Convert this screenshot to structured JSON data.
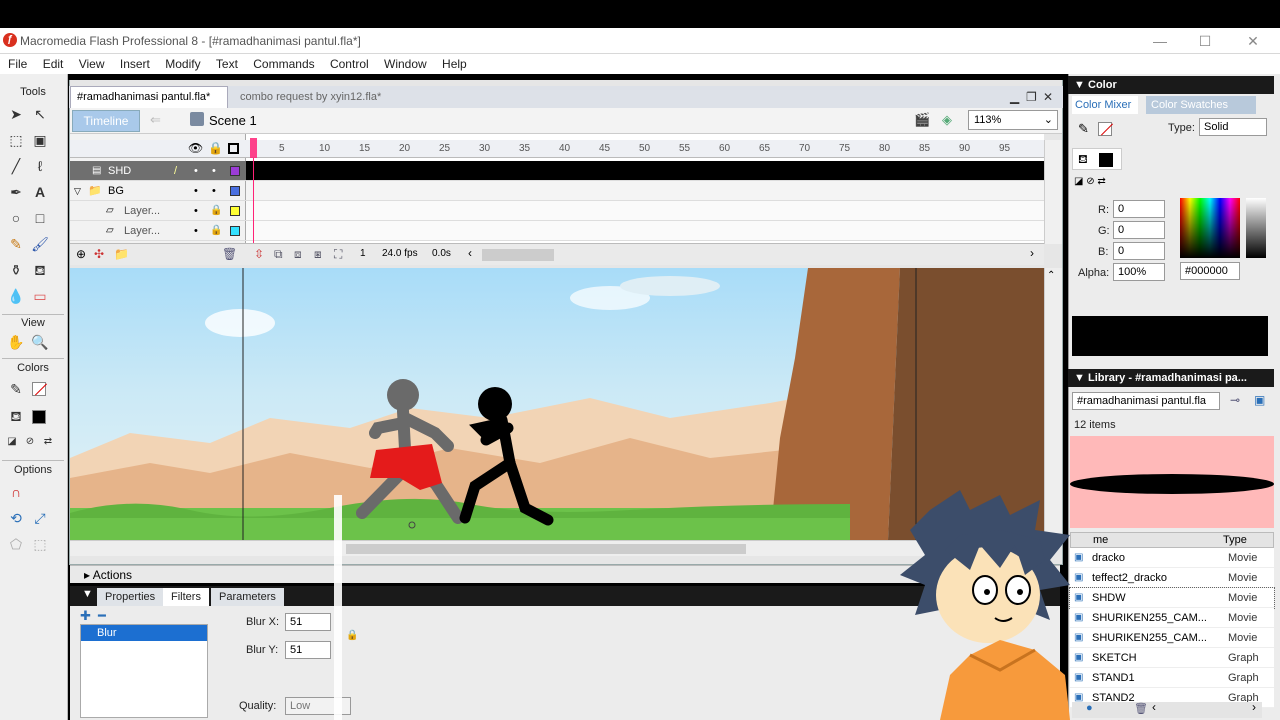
{
  "app": {
    "title": "Macromedia Flash Professional 8 - [#ramadhanimasi pantul.fla*]"
  },
  "menu": [
    "File",
    "Edit",
    "View",
    "Insert",
    "Modify",
    "Text",
    "Commands",
    "Control",
    "Window",
    "Help"
  ],
  "tools": {
    "header": "Tools",
    "view": "View",
    "colors": "Colors",
    "options": "Options"
  },
  "doc": {
    "tabs": [
      "#ramadhanimasi pantul.fla*",
      "combo request by xyin12.fla*"
    ],
    "timeline_btn": "Timeline",
    "scene": "Scene 1",
    "zoom": "113%"
  },
  "timeline": {
    "ruler": [
      "5",
      "10",
      "15",
      "20",
      "25",
      "30",
      "35",
      "40",
      "45",
      "50",
      "55",
      "60",
      "65",
      "70",
      "75",
      "80",
      "85",
      "90",
      "95"
    ],
    "layers": [
      {
        "name": "SHD",
        "color": "#9b3cd6"
      },
      {
        "name": "BG",
        "color": "#4a6fe0"
      },
      {
        "name": "Layer...",
        "color": "#ffff33"
      },
      {
        "name": "Layer...",
        "color": "#33e0ff"
      }
    ],
    "frame": "1",
    "fps": "24.0 fps",
    "time": "0.0s"
  },
  "panels": {
    "actions": "Actions",
    "prop_tabs": [
      "Properties",
      "Filters",
      "Parameters"
    ],
    "filter_item": "Blur",
    "blur_x_label": "Blur X:",
    "blur_x": "51",
    "blur_y_label": "Blur Y:",
    "blur_y": "51",
    "quality_label": "Quality:",
    "quality": "Low"
  },
  "color": {
    "title": "Color",
    "tabs": [
      "Color Mixer",
      "Color Swatches"
    ],
    "type_label": "Type:",
    "type": "Solid",
    "r_label": "R:",
    "r": "0",
    "g_label": "G:",
    "g": "0",
    "b_label": "B:",
    "b": "0",
    "alpha_label": "Alpha:",
    "alpha": "100%",
    "hex": "#000000"
  },
  "library": {
    "title": "Library - #ramadhanimasi pa...",
    "doc": "#ramadhanimasi pantul.fla",
    "count": "12 items",
    "col_name": "me",
    "col_type": "Type",
    "items": [
      {
        "name": "dracko",
        "type": "Movie"
      },
      {
        "name": "teffect2_dracko",
        "type": "Movie"
      },
      {
        "name": "SHDW",
        "type": "Movie"
      },
      {
        "name": "SHURIKEN255_CAM...",
        "type": "Movie"
      },
      {
        "name": "SHURIKEN255_CAM...",
        "type": "Movie"
      },
      {
        "name": "SKETCH",
        "type": "Graph"
      },
      {
        "name": "STAND1",
        "type": "Graph"
      },
      {
        "name": "STAND2",
        "type": "Graph"
      }
    ]
  }
}
